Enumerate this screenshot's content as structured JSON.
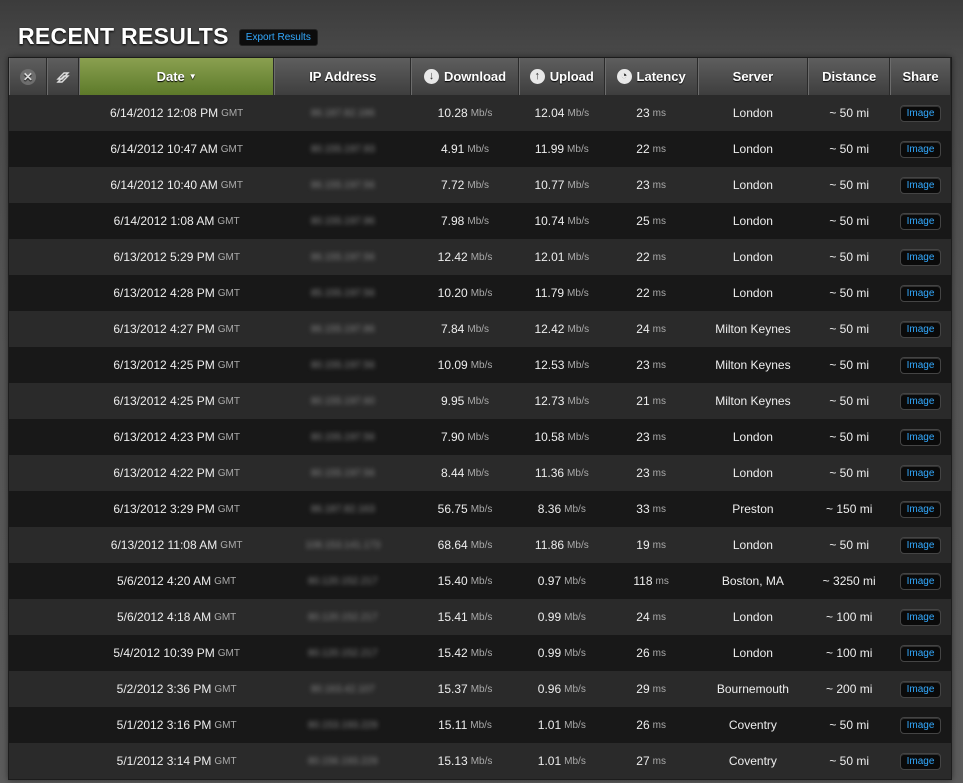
{
  "header": {
    "title": "RECENT RESULTS",
    "export_label": "Export Results"
  },
  "columns": {
    "date": "Date",
    "ip": "IP Address",
    "download": "Download",
    "upload": "Upload",
    "latency": "Latency",
    "server": "Server",
    "distance": "Distance",
    "share": "Share"
  },
  "icons": {
    "clear": "close-icon",
    "compare": "compare-icon",
    "download": "download-arrow-icon",
    "upload": "upload-arrow-icon",
    "latency": "latency-gauge-icon"
  },
  "units": {
    "speed": "Mb/s",
    "latency": "ms",
    "timezone": "GMT"
  },
  "share_label": "Image",
  "accent_color": "#7a9a3f",
  "link_color": "#33aaff",
  "rows": [
    {
      "date": "6/14/2012 12:08 PM",
      "ip": "86.187.82.186",
      "download": "10.28",
      "upload": "12.04",
      "latency": "23",
      "server": "London",
      "distance": "~ 50 mi"
    },
    {
      "date": "6/14/2012 10:47 AM",
      "ip": "80.155.197.93",
      "download": "4.91",
      "upload": "11.99",
      "latency": "22",
      "server": "London",
      "distance": "~ 50 mi"
    },
    {
      "date": "6/14/2012 10:40 AM",
      "ip": "86.155.197.56",
      "download": "7.72",
      "upload": "10.77",
      "latency": "23",
      "server": "London",
      "distance": "~ 50 mi"
    },
    {
      "date": "6/14/2012 1:08 AM",
      "ip": "80.155.197.96",
      "download": "7.98",
      "upload": "10.74",
      "latency": "25",
      "server": "London",
      "distance": "~ 50 mi"
    },
    {
      "date": "6/13/2012 5:29 PM",
      "ip": "86.155.197.56",
      "download": "12.42",
      "upload": "12.01",
      "latency": "22",
      "server": "London",
      "distance": "~ 50 mi"
    },
    {
      "date": "6/13/2012 4:28 PM",
      "ip": "85.155.197.56",
      "download": "10.20",
      "upload": "11.79",
      "latency": "22",
      "server": "London",
      "distance": "~ 50 mi"
    },
    {
      "date": "6/13/2012 4:27 PM",
      "ip": "86.155.197.86",
      "download": "7.84",
      "upload": "12.42",
      "latency": "24",
      "server": "Milton Keynes",
      "distance": "~ 50 mi"
    },
    {
      "date": "6/13/2012 4:25 PM",
      "ip": "80.155.197.56",
      "download": "10.09",
      "upload": "12.53",
      "latency": "23",
      "server": "Milton Keynes",
      "distance": "~ 50 mi"
    },
    {
      "date": "6/13/2012 4:25 PM",
      "ip": "80.155.197.60",
      "download": "9.95",
      "upload": "12.73",
      "latency": "21",
      "server": "Milton Keynes",
      "distance": "~ 50 mi"
    },
    {
      "date": "6/13/2012 4:23 PM",
      "ip": "80.155.197.56",
      "download": "7.90",
      "upload": "10.58",
      "latency": "23",
      "server": "London",
      "distance": "~ 50 mi"
    },
    {
      "date": "6/13/2012 4:22 PM",
      "ip": "80.155.197.56",
      "download": "8.44",
      "upload": "11.36",
      "latency": "23",
      "server": "London",
      "distance": "~ 50 mi"
    },
    {
      "date": "6/13/2012 3:29 PM",
      "ip": "86.187.82.163",
      "download": "56.75",
      "upload": "8.36",
      "latency": "33",
      "server": "Preston",
      "distance": "~ 150 mi"
    },
    {
      "date": "6/13/2012 11:08 AM",
      "ip": "108.153.141.173",
      "download": "68.64",
      "upload": "11.86",
      "latency": "19",
      "server": "London",
      "distance": "~ 50 mi"
    },
    {
      "date": "5/6/2012 4:20 AM",
      "ip": "80.120.152.217",
      "download": "15.40",
      "upload": "0.97",
      "latency": "118",
      "server": "Boston, MA",
      "distance": "~ 3250 mi"
    },
    {
      "date": "5/6/2012 4:18 AM",
      "ip": "80.120.152.217",
      "download": "15.41",
      "upload": "0.99",
      "latency": "24",
      "server": "London",
      "distance": "~ 100 mi"
    },
    {
      "date": "5/4/2012 10:39 PM",
      "ip": "80.120.152.217",
      "download": "15.42",
      "upload": "0.99",
      "latency": "26",
      "server": "London",
      "distance": "~ 100 mi"
    },
    {
      "date": "5/2/2012 3:36 PM",
      "ip": "80.163.42.107",
      "download": "15.37",
      "upload": "0.96",
      "latency": "29",
      "server": "Bournemouth",
      "distance": "~ 200 mi"
    },
    {
      "date": "5/1/2012 3:16 PM",
      "ip": "80.153.193.229",
      "download": "15.11",
      "upload": "1.01",
      "latency": "26",
      "server": "Coventry",
      "distance": "~ 50 mi"
    },
    {
      "date": "5/1/2012 3:14 PM",
      "ip": "80.156.193.229",
      "download": "15.13",
      "upload": "1.01",
      "latency": "27",
      "server": "Coventry",
      "distance": "~ 50 mi"
    }
  ]
}
